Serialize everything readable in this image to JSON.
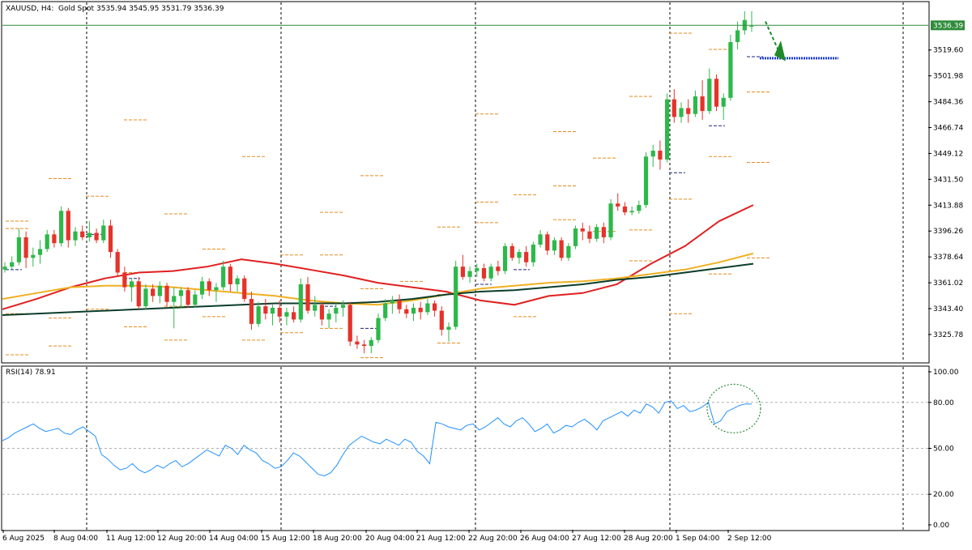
{
  "chart_data": {
    "type": "candlestick",
    "header": {
      "symbol": "XAUUSD, H4:",
      "description": "Gold Spot",
      "ohlc": "3535.94 3545.95 3531.79 3536.39"
    },
    "price_axis": {
      "ylim": [
        3307,
        3552
      ],
      "ticks": [
        "3519.60",
        "3501.98",
        "3484.36",
        "3466.74",
        "3449.12",
        "3431.50",
        "3413.88",
        "3396.26",
        "3378.64",
        "3361.02",
        "3343.40",
        "3325.78"
      ],
      "current_price_label": "3536.39",
      "current_price": 3536.39
    },
    "time_axis": {
      "ticks": [
        "6 Aug 2025",
        "8 Aug 04:00",
        "11 Aug 12:00",
        "12 Aug 20:00",
        "14 Aug 04:00",
        "15 Aug 12:00",
        "18 Aug 20:00",
        "20 Aug 04:00",
        "21 Aug 12:00",
        "22 Aug 20:00",
        "26 Aug 04:00",
        "27 Aug 12:00",
        "28 Aug 20:00",
        "1 Sep 04:00",
        "2 Sep 12:00"
      ]
    },
    "candles": [
      {
        "o": 3370,
        "h": 3375,
        "l": 3368,
        "c": 3372
      },
      {
        "o": 3372,
        "h": 3379,
        "l": 3370,
        "c": 3375
      },
      {
        "o": 3375,
        "h": 3398,
        "l": 3373,
        "c": 3392
      },
      {
        "o": 3392,
        "h": 3396,
        "l": 3371,
        "c": 3378
      },
      {
        "o": 3378,
        "h": 3385,
        "l": 3372,
        "c": 3380
      },
      {
        "o": 3380,
        "h": 3390,
        "l": 3374,
        "c": 3384
      },
      {
        "o": 3384,
        "h": 3397,
        "l": 3382,
        "c": 3394
      },
      {
        "o": 3394,
        "h": 3397,
        "l": 3385,
        "c": 3388
      },
      {
        "o": 3388,
        "h": 3413,
        "l": 3386,
        "c": 3410
      },
      {
        "o": 3410,
        "h": 3412,
        "l": 3385,
        "c": 3390
      },
      {
        "o": 3390,
        "h": 3399,
        "l": 3386,
        "c": 3396
      },
      {
        "o": 3396,
        "h": 3400,
        "l": 3390,
        "c": 3392
      },
      {
        "o": 3392,
        "h": 3403,
        "l": 3389,
        "c": 3395
      },
      {
        "o": 3395,
        "h": 3398,
        "l": 3388,
        "c": 3390
      },
      {
        "o": 3390,
        "h": 3404,
        "l": 3388,
        "c": 3400
      },
      {
        "o": 3400,
        "h": 3404,
        "l": 3378,
        "c": 3382
      },
      {
        "o": 3382,
        "h": 3384,
        "l": 3365,
        "c": 3368
      },
      {
        "o": 3368,
        "h": 3372,
        "l": 3355,
        "c": 3358
      },
      {
        "o": 3358,
        "h": 3364,
        "l": 3348,
        "c": 3362
      },
      {
        "o": 3362,
        "h": 3365,
        "l": 3343,
        "c": 3345
      },
      {
        "o": 3345,
        "h": 3360,
        "l": 3343,
        "c": 3357
      },
      {
        "o": 3357,
        "h": 3360,
        "l": 3348,
        "c": 3352
      },
      {
        "o": 3352,
        "h": 3362,
        "l": 3347,
        "c": 3359
      },
      {
        "o": 3359,
        "h": 3361,
        "l": 3345,
        "c": 3348
      },
      {
        "o": 3348,
        "h": 3358,
        "l": 3330,
        "c": 3352
      },
      {
        "o": 3352,
        "h": 3358,
        "l": 3344,
        "c": 3356
      },
      {
        "o": 3356,
        "h": 3358,
        "l": 3344,
        "c": 3346
      },
      {
        "o": 3346,
        "h": 3356,
        "l": 3344,
        "c": 3353
      },
      {
        "o": 3353,
        "h": 3365,
        "l": 3350,
        "c": 3362
      },
      {
        "o": 3362,
        "h": 3364,
        "l": 3352,
        "c": 3356
      },
      {
        "o": 3356,
        "h": 3361,
        "l": 3348,
        "c": 3358
      },
      {
        "o": 3358,
        "h": 3376,
        "l": 3356,
        "c": 3372
      },
      {
        "o": 3372,
        "h": 3374,
        "l": 3355,
        "c": 3360
      },
      {
        "o": 3360,
        "h": 3366,
        "l": 3355,
        "c": 3364
      },
      {
        "o": 3364,
        "h": 3366,
        "l": 3348,
        "c": 3350
      },
      {
        "o": 3350,
        "h": 3355,
        "l": 3329,
        "c": 3333
      },
      {
        "o": 3333,
        "h": 3348,
        "l": 3331,
        "c": 3345
      },
      {
        "o": 3345,
        "h": 3350,
        "l": 3336,
        "c": 3340
      },
      {
        "o": 3340,
        "h": 3346,
        "l": 3332,
        "c": 3344
      },
      {
        "o": 3344,
        "h": 3349,
        "l": 3334,
        "c": 3338
      },
      {
        "o": 3338,
        "h": 3344,
        "l": 3332,
        "c": 3341
      },
      {
        "o": 3341,
        "h": 3345,
        "l": 3334,
        "c": 3336
      },
      {
        "o": 3336,
        "h": 3364,
        "l": 3334,
        "c": 3360
      },
      {
        "o": 3360,
        "h": 3365,
        "l": 3340,
        "c": 3342
      },
      {
        "o": 3342,
        "h": 3352,
        "l": 3338,
        "c": 3346
      },
      {
        "o": 3346,
        "h": 3348,
        "l": 3332,
        "c": 3336
      },
      {
        "o": 3336,
        "h": 3343,
        "l": 3330,
        "c": 3340
      },
      {
        "o": 3340,
        "h": 3347,
        "l": 3334,
        "c": 3344
      },
      {
        "o": 3344,
        "h": 3349,
        "l": 3338,
        "c": 3346
      },
      {
        "o": 3346,
        "h": 3348,
        "l": 3318,
        "c": 3321
      },
      {
        "o": 3321,
        "h": 3325,
        "l": 3316,
        "c": 3319
      },
      {
        "o": 3319,
        "h": 3322,
        "l": 3313,
        "c": 3318
      },
      {
        "o": 3318,
        "h": 3324,
        "l": 3313,
        "c": 3322
      },
      {
        "o": 3322,
        "h": 3340,
        "l": 3320,
        "c": 3337
      },
      {
        "o": 3337,
        "h": 3350,
        "l": 3335,
        "c": 3347
      },
      {
        "o": 3347,
        "h": 3352,
        "l": 3340,
        "c": 3349
      },
      {
        "o": 3349,
        "h": 3353,
        "l": 3340,
        "c": 3343
      },
      {
        "o": 3343,
        "h": 3346,
        "l": 3337,
        "c": 3340
      },
      {
        "o": 3340,
        "h": 3347,
        "l": 3335,
        "c": 3344
      },
      {
        "o": 3344,
        "h": 3348,
        "l": 3336,
        "c": 3341
      },
      {
        "o": 3341,
        "h": 3350,
        "l": 3339,
        "c": 3347
      },
      {
        "o": 3347,
        "h": 3349,
        "l": 3338,
        "c": 3342
      },
      {
        "o": 3342,
        "h": 3345,
        "l": 3325,
        "c": 3329
      },
      {
        "o": 3329,
        "h": 3334,
        "l": 3321,
        "c": 3331
      },
      {
        "o": 3331,
        "h": 3376,
        "l": 3329,
        "c": 3372
      },
      {
        "o": 3372,
        "h": 3380,
        "l": 3363,
        "c": 3365
      },
      {
        "o": 3365,
        "h": 3372,
        "l": 3361,
        "c": 3369
      },
      {
        "o": 3369,
        "h": 3374,
        "l": 3365,
        "c": 3371
      },
      {
        "o": 3371,
        "h": 3374,
        "l": 3362,
        "c": 3364
      },
      {
        "o": 3364,
        "h": 3374,
        "l": 3362,
        "c": 3372
      },
      {
        "o": 3372,
        "h": 3376,
        "l": 3366,
        "c": 3369
      },
      {
        "o": 3369,
        "h": 3388,
        "l": 3367,
        "c": 3386
      },
      {
        "o": 3386,
        "h": 3388,
        "l": 3376,
        "c": 3378
      },
      {
        "o": 3378,
        "h": 3384,
        "l": 3374,
        "c": 3382
      },
      {
        "o": 3382,
        "h": 3386,
        "l": 3372,
        "c": 3375
      },
      {
        "o": 3375,
        "h": 3389,
        "l": 3372,
        "c": 3387
      },
      {
        "o": 3387,
        "h": 3397,
        "l": 3385,
        "c": 3394
      },
      {
        "o": 3394,
        "h": 3396,
        "l": 3380,
        "c": 3383
      },
      {
        "o": 3383,
        "h": 3392,
        "l": 3380,
        "c": 3390
      },
      {
        "o": 3390,
        "h": 3392,
        "l": 3376,
        "c": 3378
      },
      {
        "o": 3378,
        "h": 3388,
        "l": 3376,
        "c": 3386
      },
      {
        "o": 3386,
        "h": 3400,
        "l": 3384,
        "c": 3398
      },
      {
        "o": 3398,
        "h": 3402,
        "l": 3390,
        "c": 3396
      },
      {
        "o": 3396,
        "h": 3400,
        "l": 3388,
        "c": 3391
      },
      {
        "o": 3391,
        "h": 3401,
        "l": 3389,
        "c": 3399
      },
      {
        "o": 3399,
        "h": 3402,
        "l": 3388,
        "c": 3392
      },
      {
        "o": 3392,
        "h": 3418,
        "l": 3390,
        "c": 3415
      },
      {
        "o": 3415,
        "h": 3422,
        "l": 3410,
        "c": 3413
      },
      {
        "o": 3413,
        "h": 3416,
        "l": 3407,
        "c": 3409
      },
      {
        "o": 3409,
        "h": 3413,
        "l": 3407,
        "c": 3410
      },
      {
        "o": 3410,
        "h": 3417,
        "l": 3408,
        "c": 3414
      },
      {
        "o": 3414,
        "h": 3450,
        "l": 3412,
        "c": 3447
      },
      {
        "o": 3447,
        "h": 3455,
        "l": 3440,
        "c": 3451
      },
      {
        "o": 3451,
        "h": 3458,
        "l": 3438,
        "c": 3445
      },
      {
        "o": 3445,
        "h": 3490,
        "l": 3443,
        "c": 3486
      },
      {
        "o": 3486,
        "h": 3493,
        "l": 3470,
        "c": 3474
      },
      {
        "o": 3474,
        "h": 3484,
        "l": 3470,
        "c": 3480
      },
      {
        "o": 3480,
        "h": 3486,
        "l": 3470,
        "c": 3476
      },
      {
        "o": 3476,
        "h": 3492,
        "l": 3474,
        "c": 3488
      },
      {
        "o": 3488,
        "h": 3499,
        "l": 3472,
        "c": 3478
      },
      {
        "o": 3478,
        "h": 3507,
        "l": 3476,
        "c": 3500
      },
      {
        "o": 3500,
        "h": 3503,
        "l": 3478,
        "c": 3481
      },
      {
        "o": 3481,
        "h": 3490,
        "l": 3472,
        "c": 3487
      },
      {
        "o": 3487,
        "h": 3530,
        "l": 3485,
        "c": 3525
      },
      {
        "o": 3525,
        "h": 3539,
        "l": 3520,
        "c": 3533
      },
      {
        "o": 3533,
        "h": 3546,
        "l": 3530,
        "c": 3540
      },
      {
        "o": 3536,
        "h": 3546,
        "l": 3532,
        "c": 3536
      }
    ],
    "moving_averages": [
      {
        "color": "#e02020",
        "values": [
          3343,
          3350,
          3358,
          3364,
          3368,
          3369,
          3372,
          3377,
          3374,
          3370,
          3366,
          3361,
          3358,
          3355,
          3349,
          3346,
          3352,
          3354,
          3360,
          3374,
          3386,
          3403,
          3414
        ]
      },
      {
        "color": "#f0b020",
        "values": [
          3350,
          3354,
          3358,
          3359,
          3359,
          3358,
          3356,
          3354,
          3352,
          3349,
          3347,
          3346,
          3349,
          3353,
          3357,
          3359,
          3361,
          3362,
          3364,
          3367,
          3370,
          3375,
          3381
        ]
      },
      {
        "color": "#0b3d2a",
        "values": [
          3339,
          3340,
          3341,
          3342,
          3343,
          3344,
          3345,
          3346,
          3347,
          3347,
          3347,
          3348,
          3350,
          3353,
          3355,
          3356,
          3358,
          3360,
          3363,
          3365,
          3368,
          3371,
          3374
        ]
      }
    ],
    "rsi": {
      "label": "RSI(14) 78.91",
      "ylim": [
        0,
        100
      ],
      "ticks": [
        "100.00",
        "80.00",
        "50.00",
        "20.00",
        "0.00"
      ],
      "values": [
        55,
        57,
        60,
        62,
        64,
        66,
        63,
        61,
        62,
        63,
        60,
        59,
        62,
        64,
        61,
        58,
        46,
        43,
        39,
        36,
        37,
        40,
        36,
        34,
        36,
        39,
        37,
        40,
        42,
        38,
        40,
        43,
        46,
        49,
        47,
        45,
        52,
        50,
        46,
        52,
        49,
        47,
        42,
        40,
        37,
        38,
        42,
        47,
        45,
        41,
        37,
        33,
        32,
        34,
        39,
        46,
        52,
        55,
        58,
        56,
        54,
        53,
        56,
        54,
        52,
        56,
        54,
        48,
        45,
        40,
        67,
        66,
        64,
        63,
        62,
        65,
        66,
        62,
        64,
        67,
        70,
        66,
        64,
        68,
        70,
        66,
        61,
        63,
        66,
        60,
        62,
        65,
        64,
        67,
        69,
        66,
        62,
        68,
        70,
        72,
        74,
        71,
        75,
        73,
        79,
        77,
        73,
        80,
        81,
        76,
        78,
        74,
        75,
        77,
        80,
        66,
        68,
        74,
        76,
        78,
        79,
        78.91
      ]
    },
    "annotations": {
      "target_level": 3514,
      "circle_label": ""
    }
  }
}
